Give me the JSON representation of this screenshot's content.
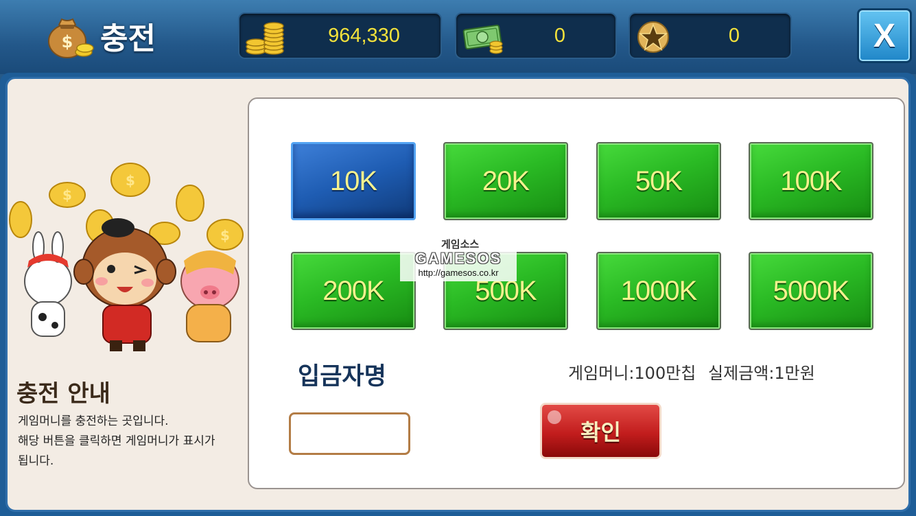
{
  "header": {
    "title": "충전",
    "gold_amount": "964,330",
    "cash_amount": "0",
    "star_amount": "0",
    "close_label": "X"
  },
  "amounts": [
    "10K",
    "20K",
    "50K",
    "100K",
    "200K",
    "500K",
    "1000K",
    "5000K"
  ],
  "selected_amount": "10K",
  "form": {
    "depositor_label": "입금자명",
    "depositor_value": "",
    "rate_info": "게임머니:100만칩 실제금액:1만원",
    "confirm_label": "확인"
  },
  "guide": {
    "title": "충전 안내",
    "line1": "게임머니를 충전하는 곳입니다.",
    "line2": "해당 버튼을 클릭하면 게임머니가 표시가",
    "line3": "됩니다."
  },
  "watermark": {
    "ko": "게임소스",
    "en": "GAMESOS",
    "url": "http://gamesos.co.kr"
  },
  "colors": {
    "header_blue": "#23588a",
    "amount_green": "#2aba24",
    "amount_selected_blue": "#1e5cb2",
    "amount_text": "#f6f28e",
    "confirm_red": "#c21d1d",
    "stat_value": "#f4e23b"
  }
}
